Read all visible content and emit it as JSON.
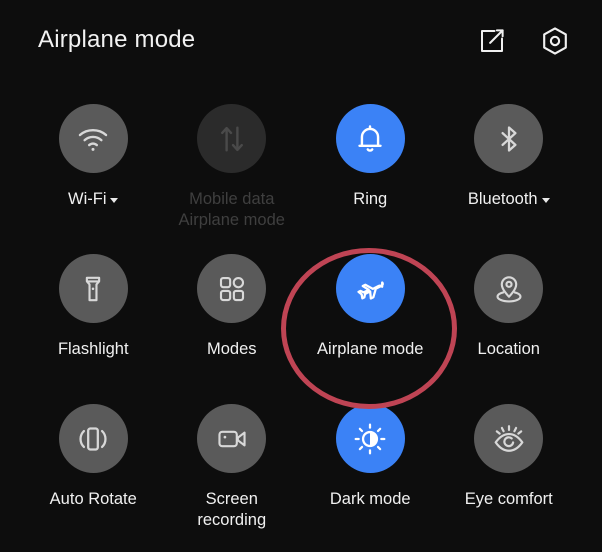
{
  "header": {
    "title": "Airplane mode",
    "edit_icon": "edit-square-icon",
    "settings_icon": "settings-hexagon-icon"
  },
  "colors": {
    "background": "#0d0d0d",
    "tile_inactive": "#5a5a5a",
    "tile_active": "#3b82f6",
    "tile_disabled": "#2b2b2b",
    "label": "#f0f0f0",
    "label_disabled": "#3f3f3f",
    "annotation": "#bf4454"
  },
  "annotation": {
    "shape": "circle",
    "target": "Airplane mode",
    "color": "#bf4454"
  },
  "tiles": [
    {
      "label": "Wi-Fi",
      "label_line2": "",
      "icon": "wifi-icon",
      "state": "inactive",
      "has_chevron": true
    },
    {
      "label": "Mobile data",
      "label_line2": "Airplane mode",
      "icon": "mobile-data-icon",
      "state": "disabled",
      "has_chevron": false
    },
    {
      "label": "Ring",
      "label_line2": "",
      "icon": "bell-icon",
      "state": "active",
      "has_chevron": false
    },
    {
      "label": "Bluetooth",
      "label_line2": "",
      "icon": "bluetooth-icon",
      "state": "inactive",
      "has_chevron": true
    },
    {
      "label": "Flashlight",
      "label_line2": "",
      "icon": "flashlight-icon",
      "state": "inactive",
      "has_chevron": false
    },
    {
      "label": "Modes",
      "label_line2": "",
      "icon": "modes-grid-icon",
      "state": "inactive",
      "has_chevron": false
    },
    {
      "label": "Airplane mode",
      "label_line2": "",
      "icon": "airplane-icon",
      "state": "active",
      "has_chevron": false
    },
    {
      "label": "Location",
      "label_line2": "",
      "icon": "location-pin-icon",
      "state": "inactive",
      "has_chevron": false
    },
    {
      "label": "Auto Rotate",
      "label_line2": "",
      "icon": "auto-rotate-icon",
      "state": "inactive",
      "has_chevron": false
    },
    {
      "label": "Screen",
      "label_line2": "recording",
      "icon": "screen-recording-icon",
      "state": "inactive",
      "has_chevron": false
    },
    {
      "label": "Dark mode",
      "label_line2": "",
      "icon": "brightness-icon",
      "state": "active",
      "has_chevron": false
    },
    {
      "label": "Eye comfort",
      "label_line2": "",
      "icon": "eye-comfort-icon",
      "state": "inactive",
      "has_chevron": false
    }
  ]
}
